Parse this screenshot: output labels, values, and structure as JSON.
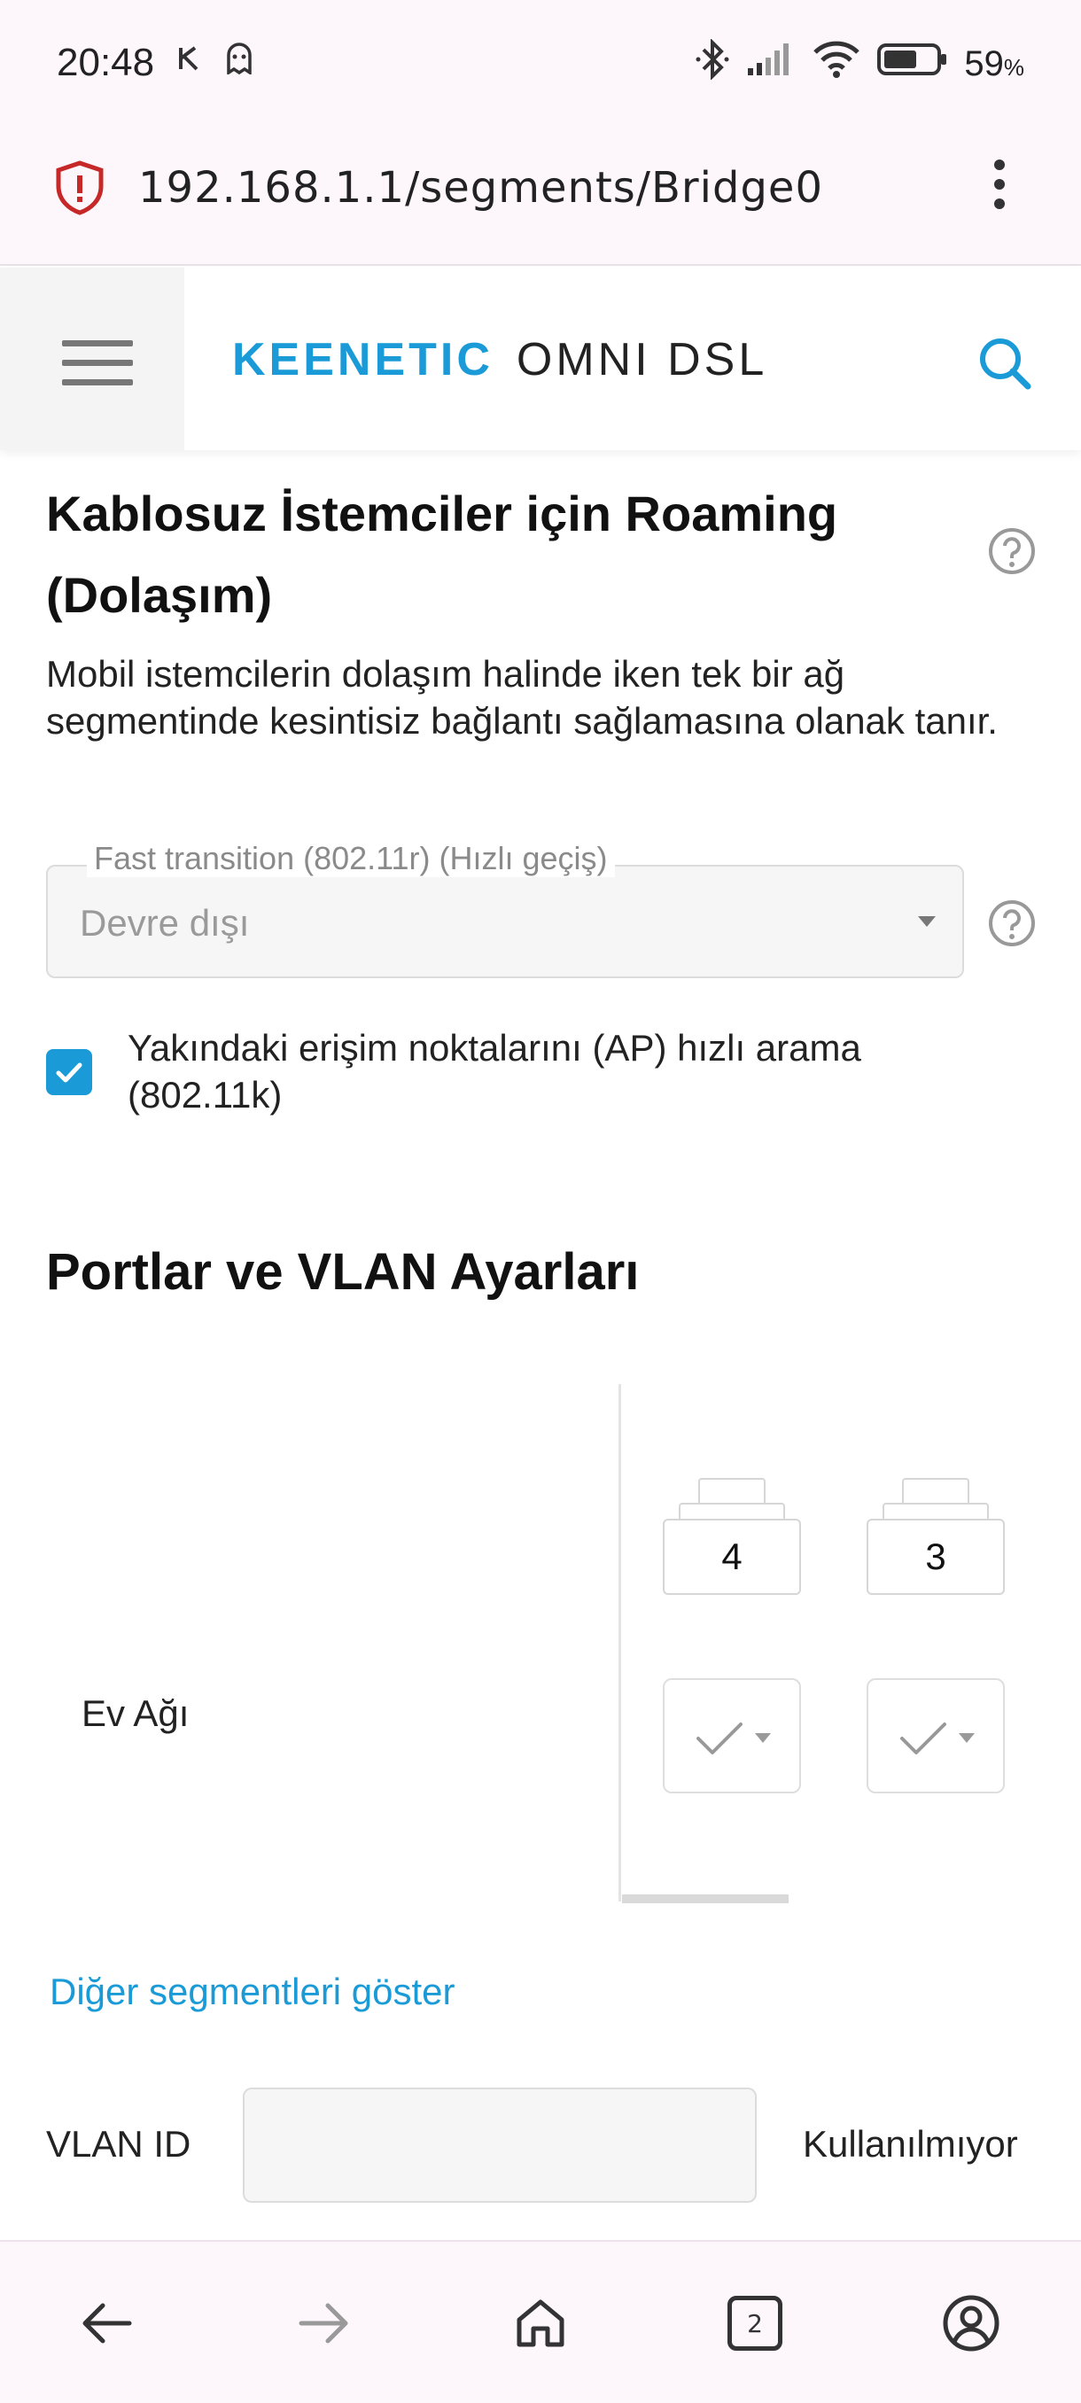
{
  "status_bar": {
    "time": "20:48",
    "battery_percent": "59",
    "battery_unit": "%",
    "icons": [
      "k-notification-icon",
      "ghost-icon",
      "bluetooth-icon",
      "signal-icon",
      "wifi-icon",
      "battery-icon"
    ]
  },
  "browser": {
    "url": "192.168.1.1/segments/Bridge0",
    "tab_count": "2"
  },
  "header": {
    "brand_main": "KEENETIC",
    "brand_model": "OMNI DSL"
  },
  "roaming": {
    "title": "Kablosuz İstemciler için Roaming (Dolaşım)",
    "description": "Mobil istemcilerin dolaşım halinde iken tek bir ağ segmentinde kesintisiz bağlantı sağlamasına olanak tanır.",
    "fast_transition_label": "Fast transition (802.11r) (Hızlı geçiş)",
    "fast_transition_value": "Devre dışı",
    "neighbor_ap_label": "Yakındaki erişim noktalarını (AP) hızlı arama (802.11k)",
    "neighbor_ap_checked": true
  },
  "ports": {
    "title": "Portlar ve VLAN Ayarları",
    "port_numbers": [
      "4",
      "3"
    ],
    "row_label": "Ev Ağı",
    "show_other_link": "Diğer segmentleri göster",
    "vlan_label": "VLAN ID",
    "vlan_value": "",
    "vlan_status": "Kullanılmıyor"
  },
  "colors": {
    "accent": "#1a9bd7",
    "shield": "#c62828"
  }
}
